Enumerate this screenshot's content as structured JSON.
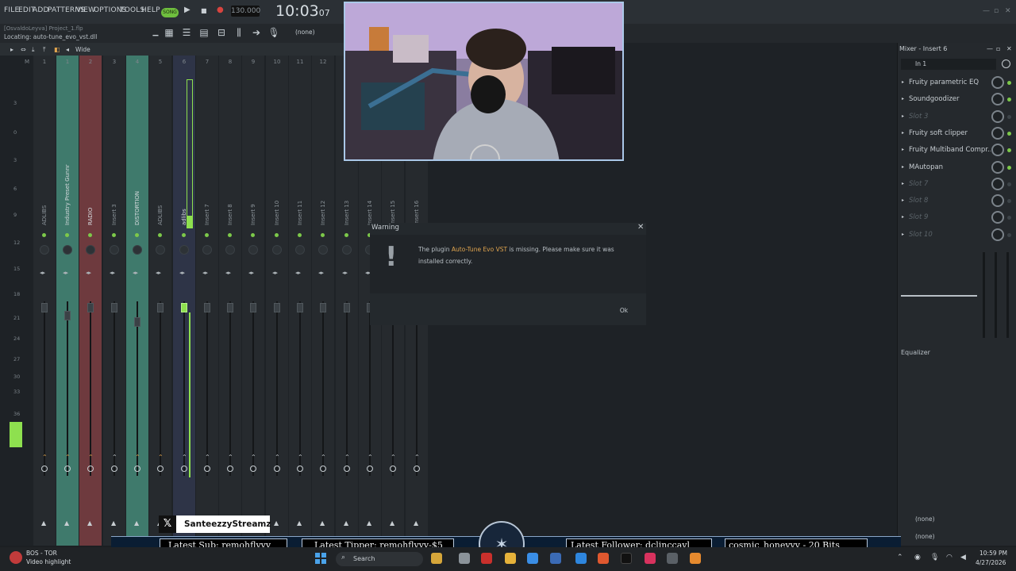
{
  "menu": [
    "FILE",
    "EDIT",
    "ADD",
    "PATTERNS",
    "VIEW",
    "OPTIONS",
    "TOOLS",
    "HELP"
  ],
  "transport": {
    "song_label": "SONG",
    "tempo": "130.000",
    "time": "10:03",
    "time_sub": "07"
  },
  "hint": {
    "project": "[OsvaldoLeyva]  Project_1.flp",
    "locating": "Locating: auto-tune_evo_vst.dll",
    "preset": "(none)"
  },
  "mixer": {
    "view_label": "Wide",
    "scale": [
      "3",
      "0",
      "3",
      "6",
      "9",
      "12",
      "15",
      "18",
      "21",
      "24",
      "27",
      "30",
      "33",
      "36"
    ],
    "strips": [
      {
        "num": "M",
        "name": "",
        "color": "#262a2e"
      },
      {
        "num": "1",
        "name": "ADLIBS",
        "color": "#262a2e"
      },
      {
        "num": "1",
        "name": "Industry Preset Gunnr",
        "color": "#3f7a6c",
        "active": true
      },
      {
        "num": "2",
        "name": "RADIO",
        "color": "#6e3a3e",
        "active": true
      },
      {
        "num": "3",
        "name": "Insert 3",
        "color": "#262a2e"
      },
      {
        "num": "4",
        "name": "DISTORTION",
        "color": "#3f7a6c",
        "active": true
      },
      {
        "num": "5",
        "name": "ADLIBS",
        "color": "#262a2e"
      },
      {
        "num": "6",
        "name": "adlibs",
        "color": "#2e3447",
        "active": true
      },
      {
        "num": "7",
        "name": "Insert 7",
        "color": "#262a2e"
      },
      {
        "num": "8",
        "name": "Insert 8",
        "color": "#262a2e"
      },
      {
        "num": "9",
        "name": "Insert 9",
        "color": "#262a2e"
      },
      {
        "num": "10",
        "name": "Insert 10",
        "color": "#262a2e"
      },
      {
        "num": "11",
        "name": "Insert 11",
        "color": "#262a2e"
      },
      {
        "num": "12",
        "name": "Insert 12",
        "color": "#262a2e"
      },
      {
        "num": "13",
        "name": "Insert 13",
        "color": "#262a2e"
      },
      {
        "num": "14",
        "name": "Insert 14",
        "color": "#262a2e"
      },
      {
        "num": "15",
        "name": "Insert 15",
        "color": "#262a2e"
      },
      {
        "num": "16",
        "name": "Insert 16",
        "color": "#262a2e"
      }
    ]
  },
  "warning": {
    "title": "Warning",
    "pre": "The plugin ",
    "plugin": "Auto-Tune Evo VST",
    "post": " is missing. Please make sure it was installed correctly.",
    "ok": "Ok"
  },
  "panel": {
    "title": "Mixer - Insert 6",
    "input": "In 1",
    "slots": [
      {
        "label": "Fruity parametric EQ",
        "empty": false
      },
      {
        "label": "Soundgoodizer",
        "empty": false
      },
      {
        "label": "Slot 3",
        "empty": true
      },
      {
        "label": "Fruity soft clipper",
        "empty": false
      },
      {
        "label": "Fruity Multiband Compr...",
        "empty": false
      },
      {
        "label": "MAutopan",
        "empty": false
      },
      {
        "label": "Slot 7",
        "empty": true
      },
      {
        "label": "Slot 8",
        "empty": true
      },
      {
        "label": "Slot 9",
        "empty": true
      },
      {
        "label": "Slot 10",
        "empty": true
      }
    ],
    "equalizer": "Equalizer",
    "out1": "(none)",
    "out2": "(none)"
  },
  "stream": {
    "social": "SanteezzyStreamz",
    "latest_sub": "Latest Sub: remohflyyy",
    "latest_tipper": "Latest Tipper: remohflyyy-$5",
    "latest_follower": "Latest Follower: dclinccayl",
    "bits": "cosmic_honeyyy - 20 Bits"
  },
  "taskbar": {
    "widget_title": "BOS - TOR",
    "widget_sub": "Video highlight",
    "search": "Search",
    "time": "10:59 PM",
    "date": "4/27/2026"
  }
}
